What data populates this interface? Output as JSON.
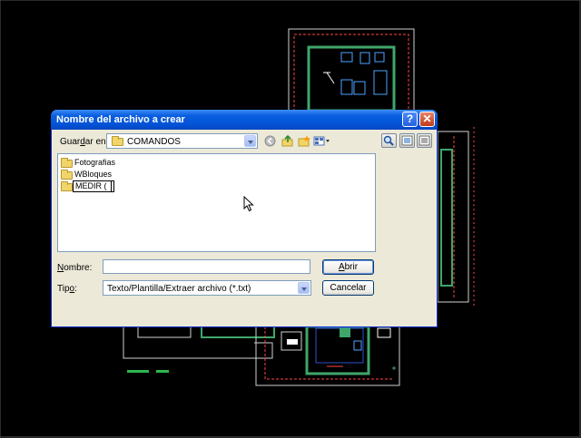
{
  "dialog": {
    "title": "Nombre del archivo a crear",
    "help_label": "?",
    "close_label": "✕",
    "save_in_label_pre": "Guar",
    "save_in_label_u": "d",
    "save_in_label_post": "ar en:",
    "current_folder": "COMANDOS",
    "files": [
      {
        "name": "Fotografias",
        "type": "folder"
      },
      {
        "name": "WBloques",
        "type": "folder"
      }
    ],
    "rename_value": "MEDIR (",
    "name_label_u": "N",
    "name_label_rest": "ombre:",
    "name_value": "",
    "type_label_pre": "Tip",
    "type_label_u": "o",
    "type_label_post": ":",
    "type_value": "Texto/Plantilla/Extraer archivo (*.txt)",
    "open_button_u": "A",
    "open_button_rest": "brir",
    "cancel_button": "Cancelar"
  },
  "icons": {
    "back": "back-icon",
    "up": "up-folder-icon",
    "new_folder": "new-folder-icon",
    "views": "views-icon",
    "search": "search-icon",
    "preview": "preview-icon",
    "tools": "tools-icon"
  },
  "colors": {
    "title_bar": "#0a5ee0",
    "dialog_bg": "#ece9d8",
    "cad_background": "#000000"
  }
}
